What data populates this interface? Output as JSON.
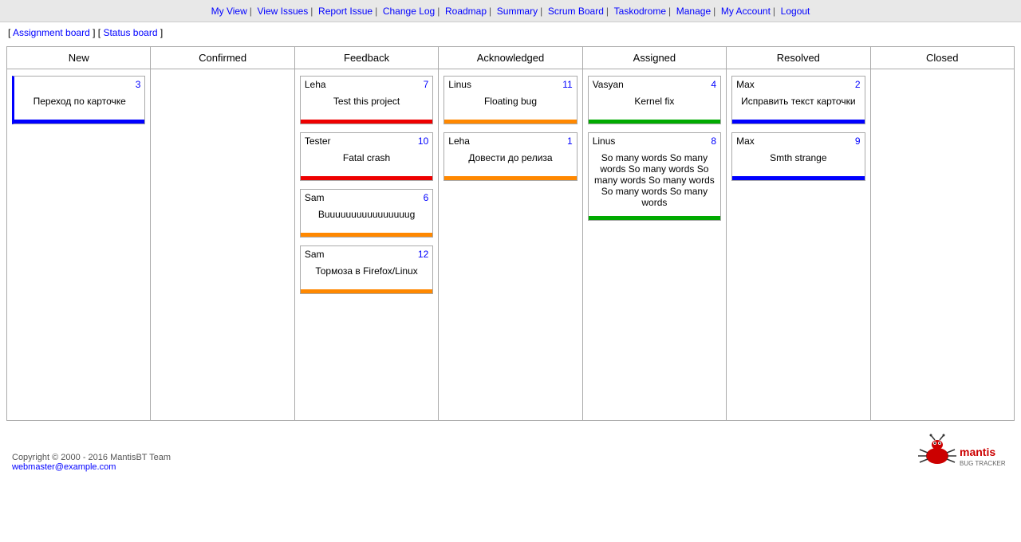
{
  "nav": {
    "items": [
      {
        "label": "My View",
        "href": "#"
      },
      {
        "label": "View Issues",
        "href": "#"
      },
      {
        "label": "Report Issue",
        "href": "#"
      },
      {
        "label": "Change Log",
        "href": "#"
      },
      {
        "label": "Roadmap",
        "href": "#"
      },
      {
        "label": "Summary",
        "href": "#"
      },
      {
        "label": "Scrum Board",
        "href": "#"
      },
      {
        "label": "Taskodrome",
        "href": "#"
      },
      {
        "label": "Manage",
        "href": "#"
      },
      {
        "label": "My Account",
        "href": "#"
      },
      {
        "label": "Logout",
        "href": "#"
      }
    ]
  },
  "breadcrumb": {
    "prefix": "[",
    "link1_label": "Assignment board",
    "separator": "] [",
    "link2_label": "Status board",
    "suffix": " ]"
  },
  "board": {
    "columns": [
      {
        "id": "new",
        "label": "New"
      },
      {
        "id": "confirmed",
        "label": "Confirmed"
      },
      {
        "id": "feedback",
        "label": "Feedback"
      },
      {
        "id": "acknowledged",
        "label": "Acknowledged"
      },
      {
        "id": "assigned",
        "label": "Assigned"
      },
      {
        "id": "resolved",
        "label": "Resolved"
      },
      {
        "id": "closed",
        "label": "Closed"
      }
    ],
    "cards": {
      "new": [
        {
          "assignee": "",
          "id": "3",
          "title": "Переход по карточке",
          "bar": "blue",
          "card_class": "card-new"
        }
      ],
      "confirmed": [],
      "feedback": [
        {
          "assignee": "Leha",
          "id": "7",
          "title": "Test this project",
          "bar": "red"
        },
        {
          "assignee": "Tester",
          "id": "10",
          "title": "Fatal crash",
          "bar": "red"
        },
        {
          "assignee": "Sam",
          "id": "6",
          "title": "Вuuuuuuuuuuuuuuuug",
          "bar": "orange"
        },
        {
          "assignee": "Sam",
          "id": "12",
          "title": "Тормоза в Firefox/Linux",
          "bar": "orange"
        }
      ],
      "acknowledged": [
        {
          "assignee": "Linus",
          "id": "11",
          "title": "Floating bug",
          "bar": "orange"
        },
        {
          "assignee": "Leha",
          "id": "1",
          "title": "Довести до релиза",
          "bar": "orange"
        }
      ],
      "assigned": [
        {
          "assignee": "Vasyan",
          "id": "4",
          "title": "Kernel fix",
          "bar": "green"
        },
        {
          "assignee": "Linus",
          "id": "8",
          "title": "So many words So many words So many words So many words So many words So many words So many words",
          "bar": "green"
        }
      ],
      "resolved": [
        {
          "assignee": "Max",
          "id": "2",
          "title": "Исправить текст карточки",
          "bar": "blue"
        },
        {
          "assignee": "Max",
          "id": "9",
          "title": "Smth strange",
          "bar": "blue"
        }
      ],
      "closed": []
    }
  },
  "footer": {
    "copyright": "Copyright © 2000 - 2016 MantisBT Team",
    "email": "webmaster@example.com"
  }
}
